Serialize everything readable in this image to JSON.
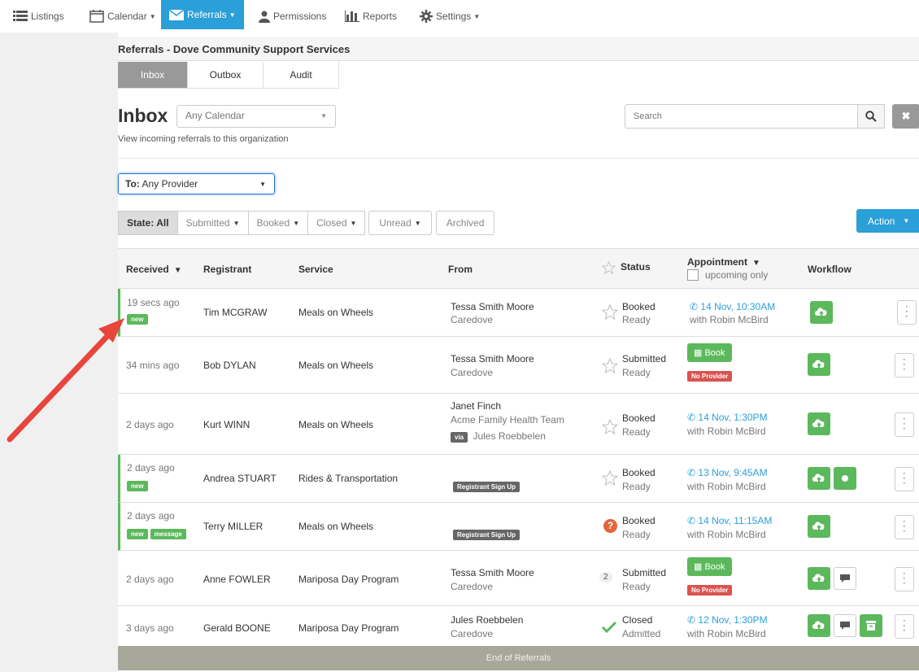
{
  "nav": {
    "listings": "Listings",
    "calendar": "Calendar",
    "referrals": "Referrals",
    "permissions": "Permissions",
    "reports": "Reports",
    "settings": "Settings"
  },
  "org_title": "Referrals - Dove Community Support Services",
  "tabs": [
    "Inbox",
    "Outbox",
    "Audit"
  ],
  "inbox": {
    "title": "Inbox",
    "calendar_select": "Any Calendar",
    "subtitle": "View incoming referrals to this organization",
    "search_placeholder": "Search"
  },
  "provider_filter": {
    "label": "To:",
    "value": "Any Provider"
  },
  "filters": {
    "state": "State: All",
    "submitted": "Submitted",
    "booked": "Booked",
    "closed": "Closed",
    "unread": "Unread",
    "archived": "Archived"
  },
  "action_label": "Action",
  "columns": {
    "received": "Received",
    "registrant": "Registrant",
    "service": "Service",
    "from": "From",
    "status": "Status",
    "appointment": "Appointment",
    "upcoming_only": "upcoming only",
    "workflow": "Workflow"
  },
  "rows": [
    {
      "received": "19 secs ago",
      "badges": [
        "new"
      ],
      "registrant": "Tim MCGRAW",
      "service": "Meals on Wheels",
      "from_name": "Tessa Smith Moore",
      "from_org": "Caredove",
      "status": "Booked",
      "substatus": "Ready",
      "appt_time": "14 Nov, 10:30AM",
      "appt_with": "with Robin McBird"
    },
    {
      "received": "34 mins ago",
      "badges": [],
      "registrant": "Bob DYLAN",
      "service": "Meals on Wheels",
      "from_name": "Tessa Smith Moore",
      "from_org": "Caredove",
      "status": "Submitted",
      "substatus": "Ready",
      "book_label": "Book",
      "no_provider": "No Provider"
    },
    {
      "received": "2 days ago",
      "badges": [],
      "registrant": "Kurt WINN",
      "service": "Meals on Wheels",
      "from_name": "Janet Finch",
      "from_org": "Acme Family Health Team",
      "via_label": "via",
      "via_name": "Jules Roebbelen",
      "status": "Booked",
      "substatus": "Ready",
      "appt_time": "14 Nov, 1:30PM",
      "appt_with": "with Robin McBird"
    },
    {
      "received": "2 days ago",
      "badges": [
        "new"
      ],
      "registrant": "Andrea STUART",
      "service": "Rides & Transportation",
      "signup": "Registrant Sign Up",
      "status": "Booked",
      "substatus": "Ready",
      "appt_time": "13 Nov, 9:45AM",
      "appt_with": "with Robin McBird"
    },
    {
      "received": "2 days ago",
      "badges": [
        "new",
        "message"
      ],
      "registrant": "Terry MILLER",
      "service": "Meals on Wheels",
      "signup": "Registrant Sign Up",
      "status": "Booked",
      "substatus": "Ready",
      "appt_time": "14 Nov, 11:15AM",
      "appt_with": "with Robin McBird"
    },
    {
      "received": "2 days ago",
      "badges": [],
      "registrant": "Anne FOWLER",
      "service": "Mariposa Day Program",
      "from_name": "Tessa Smith Moore",
      "from_org": "Caredove",
      "status_count": "2",
      "status": "Submitted",
      "substatus": "Ready",
      "book_label": "Book",
      "no_provider": "No Provider"
    },
    {
      "received": "3 days ago",
      "badges": [],
      "registrant": "Gerald BOONE",
      "service": "Mariposa Day Program",
      "from_name": "Jules Roebbelen",
      "from_org": "Caredove",
      "status": "Closed",
      "substatus": "Admitted",
      "appt_time": "12 Nov, 1:30PM",
      "appt_with": "with Robin McBird"
    }
  ],
  "end_label": "End of Referrals",
  "colors": {
    "accent": "#2a9fd8",
    "green": "#5cb85c",
    "red": "#d9534f",
    "arrow": "#e8453c"
  }
}
